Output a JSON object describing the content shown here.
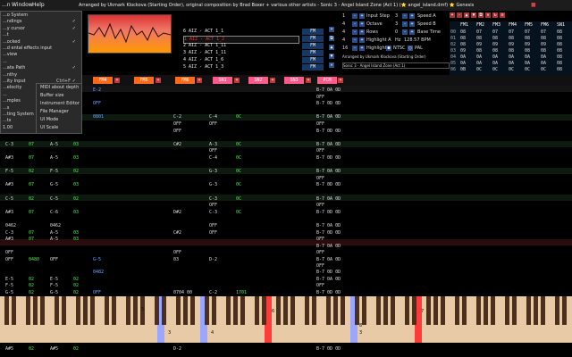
{
  "menubar": {
    "items": [
      "...n",
      "Window",
      "Help"
    ],
    "title": "Arranged by Ukmark Klockova (Starting Order), original composition by Brad Boxer + various other artists - Sonic 3 - Angel Island Zone (Act 1) (⭐ angel_island.dmf) ⭐ Genesis"
  },
  "settings_menu": {
    "items": [
      {
        "label": "...o System",
        "check": ""
      },
      {
        "label": "...ndings",
        "check": "✓"
      },
      {
        "label": "...y cursor",
        "check": "✓"
      },
      {
        "label": "...t",
        "check": ""
      },
      {
        "label": "...ocked",
        "check": "✓"
      },
      {
        "label": "...d ental effects input",
        "check": ""
      },
      {
        "label": "...view",
        "check": ""
      },
      {
        "label": "...",
        "check": ""
      },
      {
        "label": "...ata Path",
        "check": "✓"
      },
      {
        "label": "...nthy",
        "check": ""
      },
      {
        "label": "...ity Input",
        "shortcut": "Ctrl+F",
        "check": "✓"
      },
      {
        "label": "...elocity",
        "shortcut": "Shift+V",
        "check": ""
      },
      {
        "label": "...",
        "check": ""
      },
      {
        "label": "...mples",
        "check": ""
      },
      {
        "label": "...s",
        "check": ""
      },
      {
        "label": "...ting System",
        "check": ""
      },
      {
        "label": "...ts",
        "check": ""
      },
      {
        "label": "1.00",
        "check": ""
      }
    ],
    "submenu": [
      "MIDI about depth",
      "Buffer size",
      "Instrument Editor",
      "File Manager",
      "UI Mode",
      "UI Scale"
    ]
  },
  "songlist": {
    "items": [
      "6 AIZ - ACT 1_1",
      "1 AIZ - ACT 1_2",
      "2 AIZ - ACT 1_11",
      "3 AIZ - ACT 1_11",
      "4 AIZ - ACT 1_6",
      "5 AIZ - ACT 1_3"
    ],
    "selected_index": 1
  },
  "fm_buttons": [
    "FM",
    "FM",
    "FM",
    "FM",
    "FM",
    "FM"
  ],
  "params": {
    "left": [
      {
        "value": "1",
        "label": "Input Step"
      },
      {
        "value": "4",
        "label": "Octave"
      },
      {
        "value": "4",
        "label": "Rows"
      },
      {
        "value": "4",
        "label": "Highlight A"
      },
      {
        "value": "16",
        "label": "Highlight B"
      }
    ],
    "right": [
      {
        "value": "3",
        "label": "Speed A"
      },
      {
        "value": "3",
        "label": "Speed B"
      },
      {
        "value": "0",
        "label": "Base Time"
      },
      {
        "value": "128.57 BPM",
        "label": "Hz"
      },
      {
        "value": "NTSC",
        "label": ""
      }
    ],
    "pal": "PAL",
    "author": "Arranged by Ukmark Klockova (Starting Order)",
    "song": "Sonic 3 - Angel Island Zone (Act 1)"
  },
  "order_table": {
    "headers": [
      "FM1",
      "FM2",
      "FM3",
      "FM4",
      "FM5",
      "FM6",
      "SN1"
    ],
    "rows": [
      [
        "08",
        "07",
        "07",
        "07",
        "07",
        "07",
        "08"
      ],
      [
        "08",
        "08",
        "08",
        "08",
        "08",
        "08",
        "08"
      ],
      [
        "08",
        "09",
        "09",
        "09",
        "09",
        "09",
        "08"
      ],
      [
        "09",
        "08",
        "08",
        "08",
        "08",
        "08",
        "08"
      ],
      [
        "0A",
        "0A",
        "0A",
        "0A",
        "0A",
        "0A",
        "08"
      ],
      [
        "0A",
        "0A",
        "0A",
        "0A",
        "0A",
        "0A",
        "08"
      ],
      [
        "0B",
        "0C",
        "0C",
        "0C",
        "0C",
        "0C",
        "08"
      ]
    ]
  },
  "channels": [
    {
      "name": "FM4",
      "color": "#ff6a1a"
    },
    {
      "name": "FM5",
      "color": "#ff6a1a"
    },
    {
      "name": "FM6",
      "color": "#ff6a1a"
    },
    {
      "name": "SN1",
      "color": "#ff5a8a"
    },
    {
      "name": "SN2",
      "color": "#ff5a8a"
    },
    {
      "name": "SN3",
      "color": "#ff5a8a"
    },
    {
      "name": "PCM",
      "color": "#ff5a8a"
    }
  ],
  "pattern_rows": [
    [
      "",
      "",
      "",
      "",
      "E-2",
      "",
      "",
      "",
      "B-7 0A 0D"
    ],
    [
      "",
      "",
      "",
      "",
      "",
      "",
      "",
      "",
      "OFF"
    ],
    [
      "",
      "",
      "",
      "",
      "OFF",
      "",
      "",
      "",
      "B-7 0D 0D"
    ],
    [
      "",
      "",
      "",
      "",
      "",
      "",
      "",
      "",
      ""
    ],
    [
      "C-3",
      "07",
      "C-6",
      "03",
      "0801",
      "C-2",
      "C-4",
      "0C",
      "B-7 0A 0D"
    ],
    [
      "",
      "",
      "",
      "",
      "",
      "OFF",
      "OFF",
      "",
      "OFF"
    ],
    [
      "E-3",
      "07",
      "",
      "",
      "",
      "OFF",
      "",
      "",
      "B-7 0D 0D"
    ],
    [
      "",
      "",
      "",
      "",
      "",
      "",
      "",
      "",
      ""
    ],
    [
      "C-3",
      "07",
      "A-5",
      "03",
      "",
      "C#2",
      "A-3",
      "0C",
      "B-7 0A 0D"
    ],
    [
      "",
      "",
      "",
      "",
      "",
      "",
      "OFF",
      "",
      "OFF"
    ],
    [
      "A#3",
      "07",
      "A-5",
      "03",
      "",
      "",
      "C-4",
      "0C",
      "B-7 0D 0D"
    ],
    [
      "",
      "",
      "",
      "",
      "",
      "",
      "",
      "",
      ""
    ],
    [
      "F-5",
      "02",
      "F-5",
      "02",
      "",
      "",
      "G-3",
      "0C",
      "B-7 0A 0D"
    ],
    [
      "",
      "",
      "",
      "",
      "",
      "",
      "",
      "",
      "OFF"
    ],
    [
      "A#3",
      "07",
      "G-5",
      "03",
      "",
      "",
      "G-3",
      "0C",
      "B-7 0D 0D"
    ],
    [
      "",
      "",
      "",
      "",
      "",
      "",
      "",
      "",
      ""
    ],
    [
      "C-5",
      "02",
      "C-5",
      "02",
      "",
      "",
      "C-3",
      "0C",
      "B-7 0A 0D"
    ],
    [
      "",
      "",
      "",
      "",
      "",
      "",
      "OFF",
      "",
      "OFF"
    ],
    [
      "A#3",
      "07",
      "C-6",
      "03",
      "",
      "D#2",
      "C-3",
      "0C",
      "B-7 0D 0D"
    ],
    [
      "",
      "",
      "",
      "",
      "",
      "",
      "",
      "",
      ""
    ],
    [
      "0462",
      "",
      "0462",
      "",
      "",
      "",
      "OFF",
      "",
      "B-7 0A 0D"
    ]
  ],
  "lower_rows": [
    [
      "C-3",
      "07",
      "A-5",
      "03",
      "",
      "C#2",
      "OFF",
      "",
      "B-7 0D 0D"
    ],
    [
      "A#3",
      "07",
      "A-5",
      "03",
      "",
      "",
      "",
      "",
      "OFF"
    ],
    [
      "",
      "",
      "",
      "",
      "",
      "",
      "",
      "",
      "B-7 0A 0D"
    ],
    [
      "OFF",
      "",
      "",
      "",
      "",
      "OFF",
      "",
      "",
      "OFF"
    ],
    [
      "OFF",
      "0480",
      "OFF",
      "",
      "G-5",
      "03",
      "D-2",
      "",
      "B-7 0A 0D"
    ],
    [
      "",
      "",
      "",
      "",
      "",
      "",
      "",
      "",
      "OFF"
    ],
    [
      "",
      "",
      "",
      "",
      "0482",
      "",
      "",
      "",
      "B-7 0D 0D"
    ],
    [
      "E-5",
      "02",
      "E-5",
      "02",
      "",
      "",
      "",
      "",
      "B-7 0A 0D"
    ],
    [
      "F-5",
      "02",
      "F-5",
      "02",
      "",
      "",
      "",
      "",
      "OFF"
    ],
    [
      "G-5",
      "02",
      "G-5",
      "02",
      "OFF",
      "0704 00",
      "C-2",
      "1701",
      "B-7 0D 0D"
    ]
  ],
  "bottom_row": [
    "A#5",
    "02",
    "A#5",
    "02",
    "",
    "D-2",
    "",
    "",
    "B-7 0D 0D"
  ],
  "piano_labels": [
    {
      "text": "3"
    },
    {
      "text": "4"
    },
    {
      "text": "3"
    },
    {
      "text": "5"
    },
    {
      "text": "6"
    },
    {
      "text": "7"
    },
    {
      "text": "8"
    }
  ]
}
